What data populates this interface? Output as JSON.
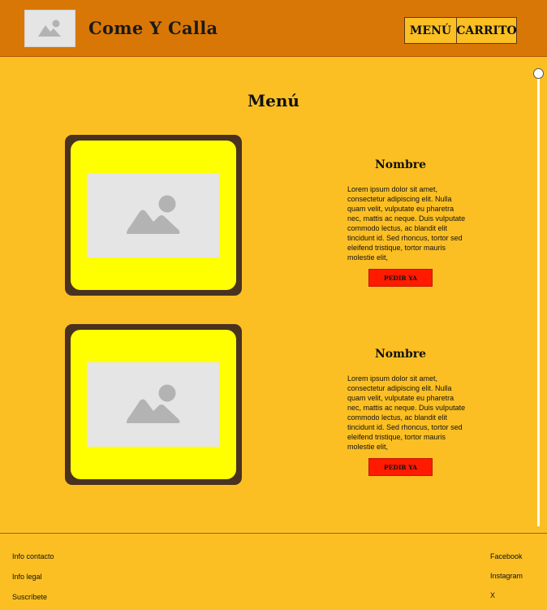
{
  "header": {
    "brand": "Come Y Calla",
    "logo_icon": "image-placeholder-icon",
    "nav": {
      "menu": "MENÚ",
      "cart": "CARRITO"
    }
  },
  "main": {
    "title": "Menú",
    "items": [
      {
        "name": "Nombre",
        "description": "Lorem ipsum dolor sit amet, consectetur adipiscing elit. Nulla quam velit, vulputate eu pharetra nec, mattis ac neque. Duis vulputate commodo lectus, ac blandit elit tincidunt id. Sed rhoncus, tortor sed eleifend tristique, tortor mauris molestie elit,",
        "button": "PEDIR YA",
        "image_icon": "image-placeholder-icon"
      },
      {
        "name": "Nombre",
        "description": "Lorem ipsum dolor sit amet, consectetur adipiscing elit. Nulla quam velit, vulputate eu pharetra nec, mattis ac neque. Duis vulputate commodo lectus, ac blandit elit tincidunt id. Sed rhoncus, tortor sed eleifend tristique, tortor mauris molestie elit,",
        "button": "PEDIR YA",
        "image_icon": "image-placeholder-icon"
      }
    ]
  },
  "footer": {
    "left": [
      "Info contacto",
      "Info legal",
      "Suscríbete"
    ],
    "right": [
      "Facebook",
      "Instagram",
      "X"
    ]
  },
  "colors": {
    "header_bg": "#d97706",
    "page_bg": "#fbbf24",
    "card_frame": "#4a3220",
    "card_fill": "#ffff00",
    "order_button": "#ff1a00"
  }
}
